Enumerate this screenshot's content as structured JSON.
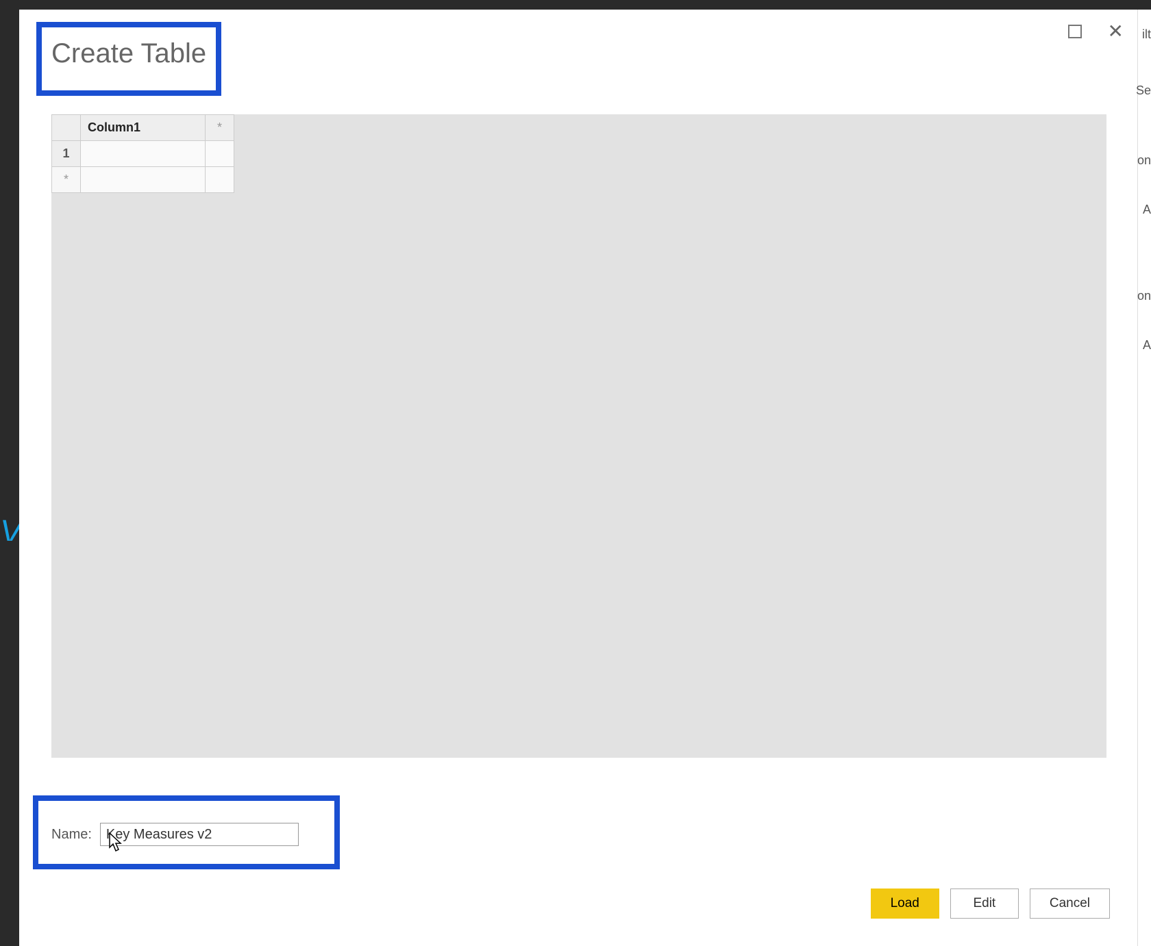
{
  "dialog": {
    "title": "Create Table",
    "window_controls": {
      "maximize": "maximize",
      "close": "close"
    }
  },
  "grid": {
    "columns": [
      "Column1"
    ],
    "add_column_marker": "*",
    "rows": [
      {
        "num": "1",
        "cells": [
          ""
        ]
      }
    ],
    "add_row_marker": "*"
  },
  "name_field": {
    "label": "Name:",
    "value": "Key Measures v2"
  },
  "buttons": {
    "load": "Load",
    "edit": "Edit",
    "cancel": "Cancel"
  },
  "background_panel": {
    "fragments": [
      "ilt",
      "Se",
      "on",
      "A",
      "on",
      "A"
    ]
  },
  "highlight_color": "#1a4fd1"
}
